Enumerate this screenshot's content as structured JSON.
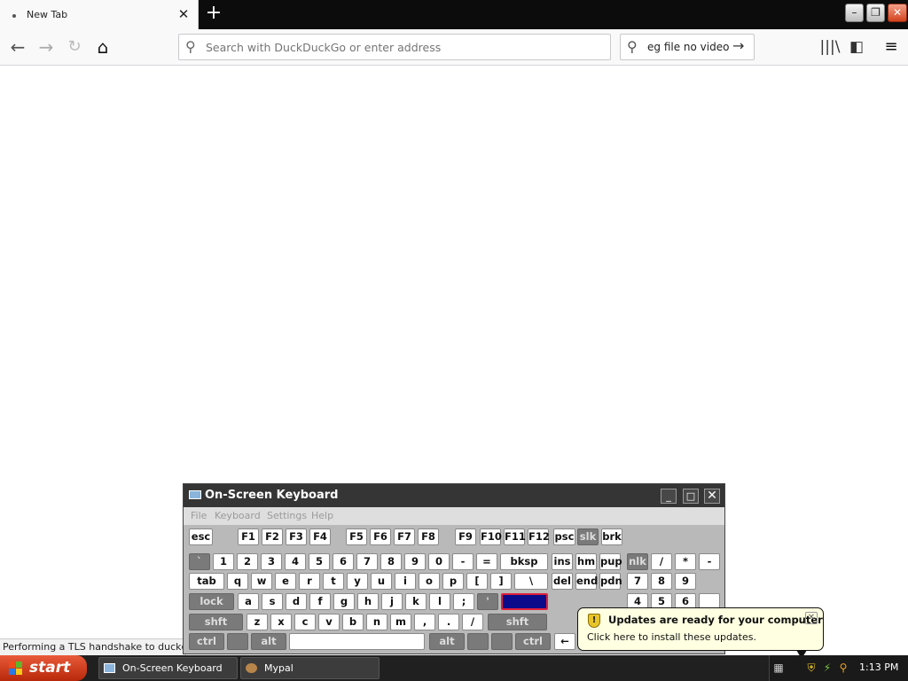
{
  "browser": {
    "tab_title": "New Tab",
    "tab_close": "✕",
    "new_tab": "+",
    "window_controls": {
      "minimize": "–",
      "restore": "❐",
      "close": "✕"
    },
    "nav": {
      "back": "←",
      "forward": "→",
      "reload": "↻",
      "home": "⌂"
    },
    "url_placeholder": "Search with DuckDuckGo or enter address",
    "search_value": "eg file no video",
    "search_go": "→",
    "toolbar": {
      "library": "|||\\",
      "sidebar": "◧",
      "menu": "≡"
    },
    "status_text": "Performing a TLS handshake to duckduckg"
  },
  "osk": {
    "title": "On-Screen Keyboard",
    "controls": {
      "minimize": "_",
      "maximize": "□",
      "close": "✕"
    },
    "menu": [
      "File",
      "Keyboard",
      "Settings",
      "Help"
    ],
    "keys": {
      "fn_row": [
        "esc",
        "F1",
        "F2",
        "F3",
        "F4",
        "F5",
        "F6",
        "F7",
        "F8",
        "F9",
        "F10",
        "F11",
        "F12",
        "psc",
        "slk",
        "brk"
      ],
      "num_row": [
        "`",
        "1",
        "2",
        "3",
        "4",
        "5",
        "6",
        "7",
        "8",
        "9",
        "0",
        "-",
        "=",
        "bksp",
        "ins",
        "hm",
        "pup",
        "nlk",
        "/",
        "*",
        "-"
      ],
      "tab_row": [
        "tab",
        "q",
        "w",
        "e",
        "r",
        "t",
        "y",
        "u",
        "i",
        "o",
        "p",
        "[",
        "]",
        "\\",
        "del",
        "end",
        "pdn",
        "7",
        "8",
        "9"
      ],
      "caps_row": [
        "lock",
        "a",
        "s",
        "d",
        "f",
        "g",
        "h",
        "j",
        "k",
        "l",
        ";",
        "'",
        "",
        "4",
        "5",
        "6",
        "+"
      ],
      "shift_row": [
        "shft",
        "z",
        "x",
        "c",
        "v",
        "b",
        "n",
        "m",
        ",",
        ".",
        "/",
        "shft"
      ],
      "ctrl_row": [
        "ctrl",
        "",
        "alt",
        "",
        "alt",
        "",
        "",
        "ctrl",
        "←"
      ]
    }
  },
  "notification": {
    "title": "Updates are ready for your computer",
    "body": "Click here to install these updates.",
    "close": "✕",
    "shield": "!"
  },
  "taskbar": {
    "start_label": "start",
    "tasks": [
      {
        "label": "On-Screen Keyboard",
        "icon": "keyboard-icon"
      },
      {
        "label": "Mypal",
        "icon": "mypal-icon"
      }
    ],
    "clock": "1:13 PM"
  },
  "colors": {
    "tabbar": "#0c0c0d",
    "taskbar": "#202020",
    "start": "#c8341a",
    "osk_highlight": "#0a0a8a",
    "tooltip_bg": "#ffffe1"
  }
}
